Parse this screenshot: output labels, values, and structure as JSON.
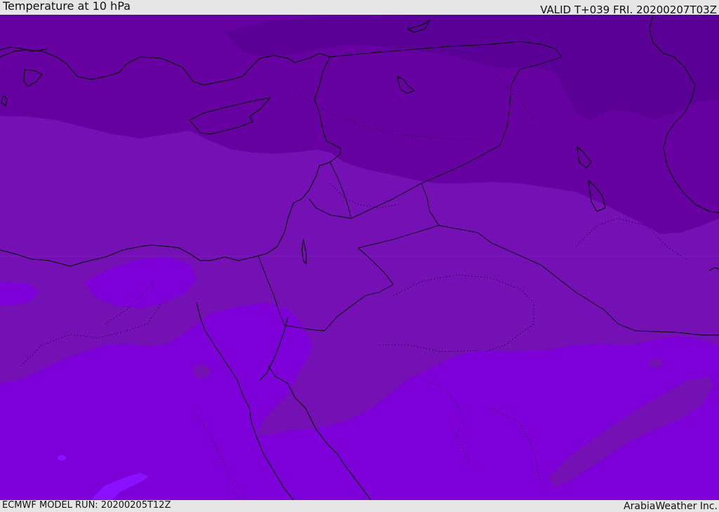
{
  "header": {
    "title": "Temperature at 10 hPa",
    "valid": "VALID T+039 FRI. 20200207T03Z"
  },
  "footer": {
    "model_run": "ECMWF MODEL RUN: 20200205T12Z",
    "credit": "ArabiaWeather Inc."
  },
  "map": {
    "colors": {
      "band_coldest": "#5a0096",
      "band_cold": "#6600a0",
      "band_mid": "#7410b4",
      "band_warm": "#7d00d8",
      "band_warmest_patch": "#8a10ff",
      "coastline": "#000000"
    }
  }
}
